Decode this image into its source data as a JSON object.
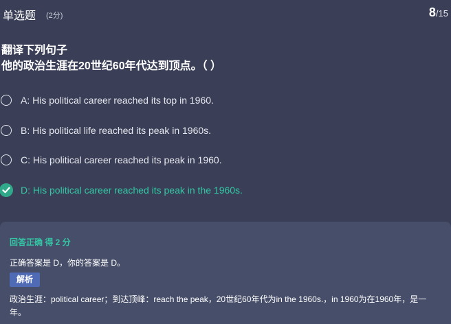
{
  "header": {
    "question_type": "单选题",
    "score": "(2分)",
    "progress_current": "8",
    "progress_separator": "/",
    "progress_total": "15"
  },
  "question": {
    "instruction": "翻译下列句子",
    "sentence": "他的政治生涯在20世纪60年代达到顶点。（ ）"
  },
  "options": [
    {
      "text": "A: His political career reached its top in 1960.",
      "selected": false
    },
    {
      "text": "B: His political life reached its peak in 1960s.",
      "selected": false
    },
    {
      "text": "C: His political career reached its peak in 1960.",
      "selected": false
    },
    {
      "text": "D: His political career reached its peak in the 1960s.",
      "selected": true
    }
  ],
  "result": {
    "title": "回答正确 得 2 分",
    "answer_line": "正确答案是 D，你的答案是 D。",
    "analysis_label": "解析",
    "analysis_text": "政治生涯：political career；到达顶峰：reach the peak，20世纪60年代为in the 1960s.，in 1960为在1960年，是一年。"
  },
  "colors": {
    "background": "#3a3f57",
    "result_panel": "#474e69",
    "correct_green": "#33c7a5",
    "check_circle": "#2fa98a",
    "tag_blue": "#4f6bb5"
  }
}
